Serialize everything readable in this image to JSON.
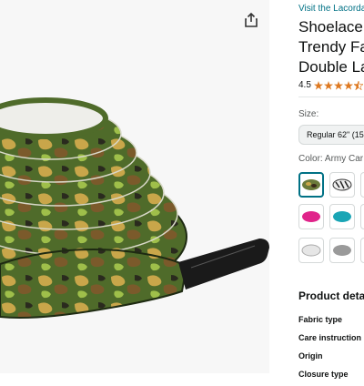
{
  "product": {
    "store_link": "Visit the Lacorda",
    "title_lines": [
      "Shoelace",
      "Trendy Fa",
      "Double La"
    ],
    "rating": "4.5",
    "stars_value": 4.5,
    "stars_max": 5
  },
  "options": {
    "size_label": "Size:",
    "size_value": "Regular 62\" (15",
    "color_label": "Color: Army Car",
    "swatches": [
      {
        "name": "camo-swatch",
        "color": "#6b7a3a",
        "selected": true
      },
      {
        "name": "zebra-swatch",
        "color": "#333333",
        "selected": false
      },
      {
        "name": "black-swatch",
        "color": "#222222",
        "selected": false
      },
      {
        "name": "pink-swatch",
        "color": "#e0248a",
        "selected": false
      },
      {
        "name": "teal-swatch",
        "color": "#1aa5b5",
        "selected": false
      },
      {
        "name": "dark-swatch",
        "color": "#3a3a3a",
        "selected": false
      },
      {
        "name": "white-swatch",
        "color": "#e6e6e6",
        "selected": false
      },
      {
        "name": "grey-swatch",
        "color": "#9a9a9a",
        "selected": false
      },
      {
        "name": "light-swatch",
        "color": "#cfcfcf",
        "selected": false
      }
    ]
  },
  "details": {
    "heading": "Product deta",
    "rows": [
      "Fabric type",
      "Care instruction",
      "Origin",
      "Closure type"
    ]
  },
  "colors": {
    "link": "#007185",
    "star": "#de7921",
    "selected_border": "#007185"
  },
  "icons": {
    "share": "share-icon"
  }
}
